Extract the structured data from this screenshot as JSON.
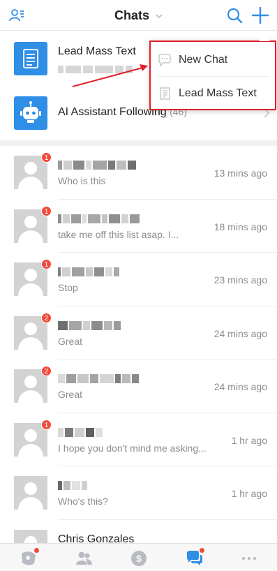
{
  "header": {
    "title": "Chats",
    "left_icon": "contacts-icon",
    "search_icon": "search-icon",
    "add_icon": "plus-icon"
  },
  "special_rows": [
    {
      "label": "Lead Mass Text",
      "count": "",
      "icon": "document-icon"
    },
    {
      "label": "AI Assistant Following",
      "count": "(46)",
      "icon": "robot-icon"
    }
  ],
  "dropdown": {
    "items": [
      {
        "label": "New Chat",
        "icon": "chat-bubble-icon"
      },
      {
        "label": "Lead Mass Text",
        "icon": "document-icon"
      }
    ]
  },
  "chats": [
    {
      "name": "",
      "message": "Who is this",
      "time": "13 mins ago",
      "unread": "1"
    },
    {
      "name": "",
      "message": "take me off this list asap. I...",
      "time": "18 mins ago",
      "unread": "1"
    },
    {
      "name": "",
      "message": "Stop",
      "time": "23 mins ago",
      "unread": "1"
    },
    {
      "name": "",
      "message": "Great",
      "time": "24 mins ago",
      "unread": "2"
    },
    {
      "name": "",
      "message": "Great",
      "time": "24 mins ago",
      "unread": "2"
    },
    {
      "name": "",
      "message": "I hope you don't mind me asking...",
      "time": "1 hr ago",
      "unread": "1"
    },
    {
      "name": "",
      "message": "Who's this?",
      "time": "1 hr ago",
      "unread": ""
    },
    {
      "name": "Chris Gonzales",
      "message": "",
      "time": "",
      "unread": ""
    }
  ],
  "tabbar": {
    "tabs": [
      {
        "icon": "leads-icon",
        "has_dot": true
      },
      {
        "icon": "people-icon",
        "has_dot": false
      },
      {
        "icon": "dollar-icon",
        "has_dot": false
      },
      {
        "icon": "chats-icon",
        "has_dot": true,
        "active": true
      },
      {
        "icon": "more-icon",
        "has_dot": false
      }
    ]
  },
  "colors": {
    "accent": "#2f8ee6",
    "badge": "#f04b3c",
    "highlight_border": "#e0202a"
  }
}
